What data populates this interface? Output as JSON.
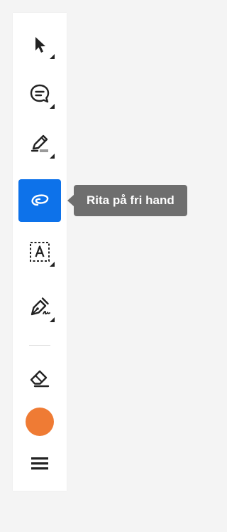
{
  "toolbar": {
    "tools": [
      {
        "id": "select",
        "icon": "arrow-pointer-icon",
        "has_menu": true
      },
      {
        "id": "comment",
        "icon": "comment-bubble-icon",
        "has_menu": true
      },
      {
        "id": "highlight",
        "icon": "highlighter-pen-icon",
        "has_menu": true
      },
      {
        "id": "draw-freehand",
        "icon": "freehand-loop-icon",
        "has_menu": false,
        "active": true
      },
      {
        "id": "text-box",
        "icon": "text-box-icon",
        "has_menu": true
      },
      {
        "id": "sign",
        "icon": "pen-nib-signature-icon",
        "has_menu": true
      },
      {
        "id": "eraser",
        "icon": "eraser-icon",
        "has_menu": false
      },
      {
        "id": "color",
        "icon": "color-swatch",
        "has_menu": false
      },
      {
        "id": "line-weight",
        "icon": "line-weight-icon",
        "has_menu": false
      }
    ],
    "active_tool_color": "#0d72ea",
    "current_color": "#ef7b34"
  },
  "tooltip": {
    "text": "Rita på fri hand"
  }
}
